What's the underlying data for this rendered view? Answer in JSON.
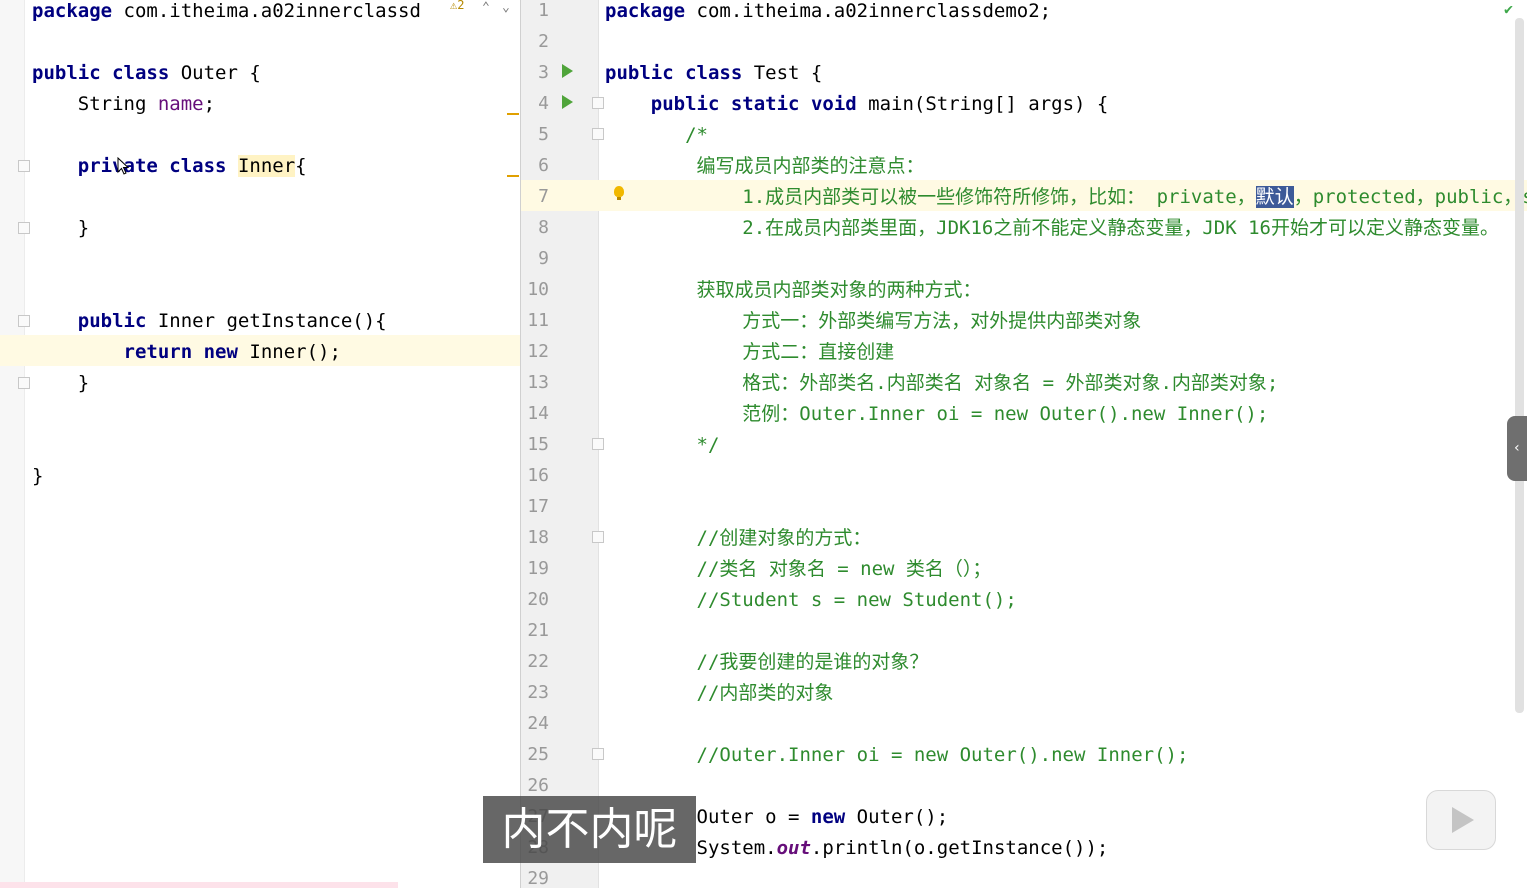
{
  "left_editor": {
    "inspection_count": "2",
    "lines": [
      {
        "tokens": [
          {
            "t": "package",
            "c": "kw"
          },
          {
            "t": " com.itheima.a02innerclassd"
          }
        ]
      },
      {
        "tokens": []
      },
      {
        "tokens": [
          {
            "t": "public",
            "c": "kw"
          },
          {
            "t": " "
          },
          {
            "t": "class",
            "c": "kw"
          },
          {
            "t": " Outer {"
          }
        ]
      },
      {
        "tokens": [
          {
            "t": "    String "
          },
          {
            "t": "name",
            "c": "fld"
          },
          {
            "t": ";"
          }
        ]
      },
      {
        "tokens": []
      },
      {
        "tokens": [
          {
            "t": "    "
          },
          {
            "t": "private",
            "c": "kw"
          },
          {
            "t": " "
          },
          {
            "t": "class",
            "c": "kw"
          },
          {
            "t": " "
          },
          {
            "t": "Inner",
            "c": "hl-yellow"
          },
          {
            "t": "{"
          }
        ]
      },
      {
        "tokens": []
      },
      {
        "tokens": [
          {
            "t": "    }"
          }
        ]
      },
      {
        "tokens": []
      },
      {
        "tokens": []
      },
      {
        "tokens": [
          {
            "t": "    "
          },
          {
            "t": "public",
            "c": "kw"
          },
          {
            "t": " Inner getInstance(){"
          }
        ]
      },
      {
        "tokens": [
          {
            "t": "        "
          },
          {
            "t": "return",
            "c": "kw"
          },
          {
            "t": " "
          },
          {
            "t": "new",
            "c": "kw"
          },
          {
            "t": " Inner();"
          }
        ]
      },
      {
        "tokens": [
          {
            "t": "    }"
          }
        ]
      },
      {
        "tokens": []
      },
      {
        "tokens": []
      },
      {
        "tokens": [
          {
            "t": "}"
          }
        ]
      }
    ]
  },
  "right_editor": {
    "lines": [
      {
        "n": "1",
        "tokens": [
          {
            "t": "package",
            "c": "kw"
          },
          {
            "t": " com.itheima.a02innerclassdemo2;"
          }
        ]
      },
      {
        "n": "2",
        "tokens": []
      },
      {
        "n": "3",
        "tokens": [
          {
            "t": "public",
            "c": "kw"
          },
          {
            "t": " "
          },
          {
            "t": "class",
            "c": "kw"
          },
          {
            "t": " Test {"
          }
        ]
      },
      {
        "n": "4",
        "tokens": [
          {
            "t": "    "
          },
          {
            "t": "public",
            "c": "kw"
          },
          {
            "t": " "
          },
          {
            "t": "static",
            "c": "kw"
          },
          {
            "t": " "
          },
          {
            "t": "void",
            "c": "kw"
          },
          {
            "t": " main(String[] args) {"
          }
        ]
      },
      {
        "n": "5",
        "tokens": [
          {
            "t": "       /*",
            "c": "cm"
          }
        ]
      },
      {
        "n": "6",
        "tokens": [
          {
            "t": "        编写成员内部类的注意点：",
            "c": "cm"
          }
        ]
      },
      {
        "n": "7",
        "tokens": [
          {
            "t": "            1.成员内部类可以被一些修饰符所修饰，比如： private，",
            "c": "cm"
          },
          {
            "t": "默认",
            "c": "hl-sel"
          },
          {
            "t": "，protected，public，static等",
            "c": "cm"
          }
        ]
      },
      {
        "n": "8",
        "tokens": [
          {
            "t": "            2.在成员内部类里面，JDK16之前不能定义静态变量，JDK 16开始才可以定义静态变量。",
            "c": "cm"
          }
        ]
      },
      {
        "n": "9",
        "tokens": []
      },
      {
        "n": "10",
        "tokens": [
          {
            "t": "        获取成员内部类对象的两种方式：",
            "c": "cm"
          }
        ]
      },
      {
        "n": "11",
        "tokens": [
          {
            "t": "            方式一：外部类编写方法，对外提供内部类对象",
            "c": "cm"
          }
        ]
      },
      {
        "n": "12",
        "tokens": [
          {
            "t": "            方式二：直接创建",
            "c": "cm"
          }
        ]
      },
      {
        "n": "13",
        "tokens": [
          {
            "t": "            格式：外部类名.内部类名 对象名 = 外部类对象.内部类对象;",
            "c": "cm"
          }
        ]
      },
      {
        "n": "14",
        "tokens": [
          {
            "t": "            范例：Outer.Inner oi = new Outer().new Inner();",
            "c": "cm"
          }
        ]
      },
      {
        "n": "15",
        "tokens": [
          {
            "t": "        */",
            "c": "cm"
          }
        ]
      },
      {
        "n": "16",
        "tokens": []
      },
      {
        "n": "17",
        "tokens": []
      },
      {
        "n": "18",
        "tokens": [
          {
            "t": "        //创建对象的方式：",
            "c": "cm"
          }
        ]
      },
      {
        "n": "19",
        "tokens": [
          {
            "t": "        //类名 对象名 = new 类名（）；",
            "c": "cm"
          }
        ]
      },
      {
        "n": "20",
        "tokens": [
          {
            "t": "        //Student s = new Student();",
            "c": "cm"
          }
        ]
      },
      {
        "n": "21",
        "tokens": []
      },
      {
        "n": "22",
        "tokens": [
          {
            "t": "        //我要创建的是谁的对象？",
            "c": "cm"
          }
        ]
      },
      {
        "n": "23",
        "tokens": [
          {
            "t": "        //内部类的对象",
            "c": "cm"
          }
        ]
      },
      {
        "n": "24",
        "tokens": []
      },
      {
        "n": "25",
        "tokens": [
          {
            "t": "        //Outer.Inner oi = new Outer().new Inner();",
            "c": "cm"
          }
        ]
      },
      {
        "n": "26",
        "tokens": []
      },
      {
        "n": "27",
        "tokens": [
          {
            "t": "        Outer o = "
          },
          {
            "t": "new",
            "c": "kw"
          },
          {
            "t": " Outer();"
          }
        ]
      },
      {
        "n": "28",
        "tokens": [
          {
            "t": "        System."
          },
          {
            "t": "out",
            "c": "itf"
          },
          {
            "t": ".println(o.getInstance());"
          }
        ]
      },
      {
        "n": "29",
        "tokens": []
      }
    ]
  },
  "subtitle": "内不内呢",
  "icons": {
    "inspection": "warning-icon",
    "run": "run-gutter-icon",
    "bulb": "intention-bulb-icon",
    "check": "analysis-ok-icon",
    "play": "play-button-icon"
  },
  "colors": {
    "keyword": "#000080",
    "comment": "#2e8b2e",
    "field": "#660e7a",
    "selection": "#3d5a98",
    "current_line": "#fffae3"
  }
}
